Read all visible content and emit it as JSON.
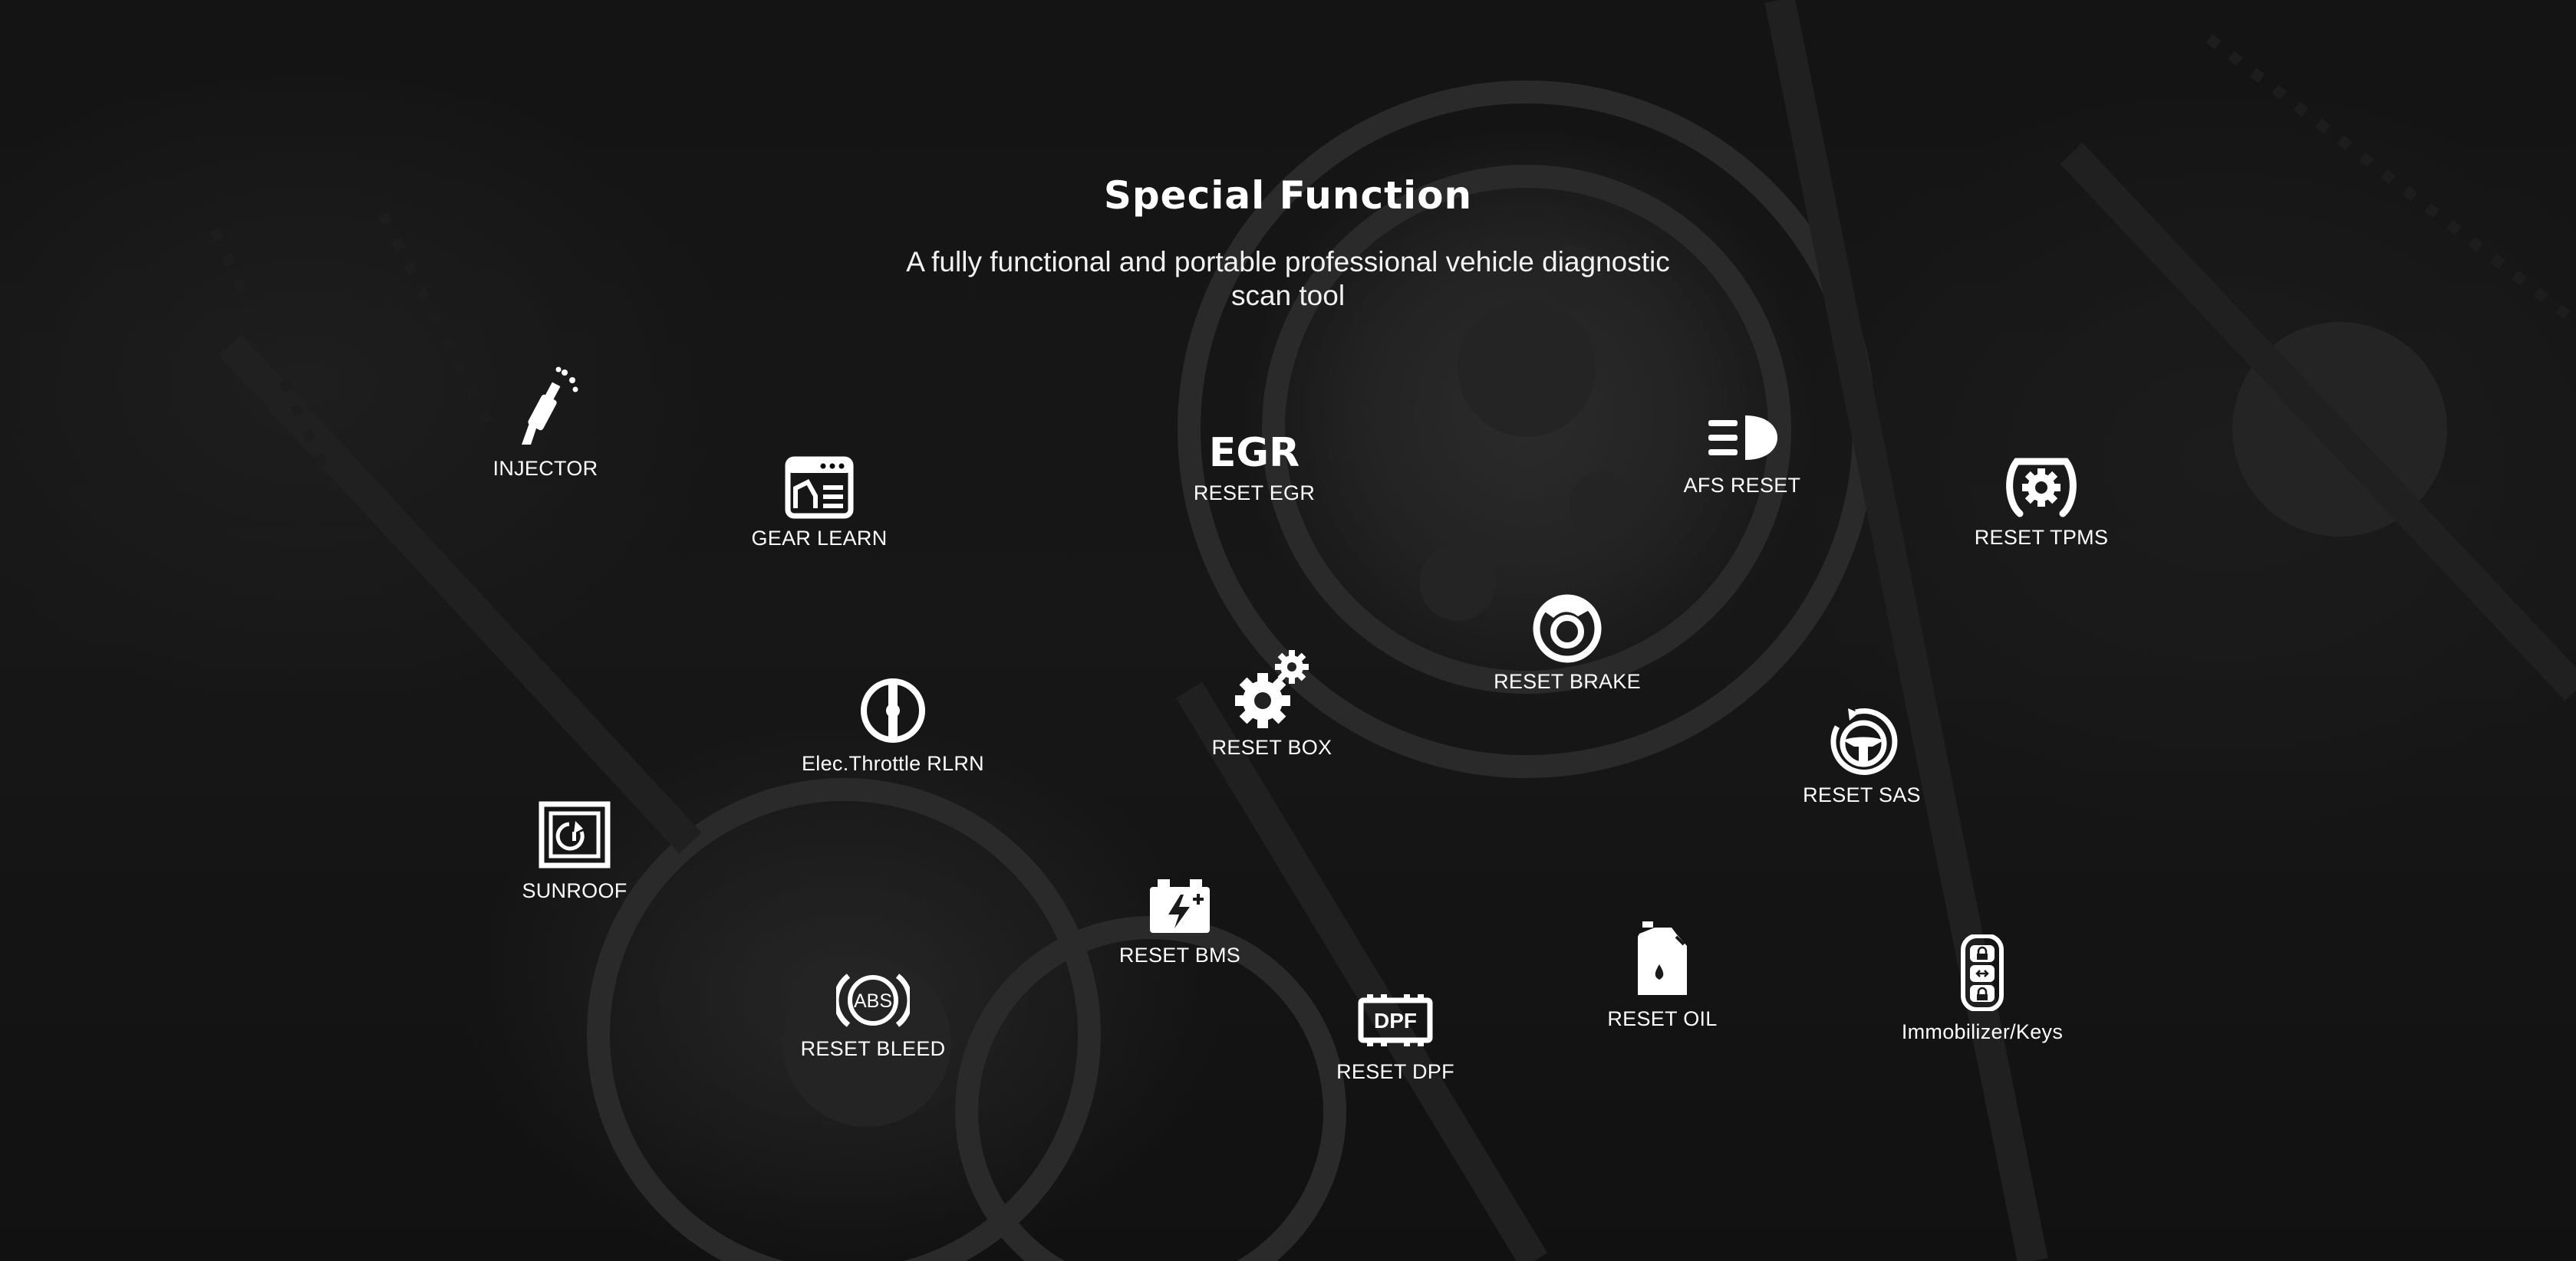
{
  "page": {
    "title": "Special Function",
    "subtitle": "A fully functional and portable professional vehicle diagnostic scan tool"
  },
  "colors": {
    "text": "#ffffff",
    "background": "#161616"
  },
  "features": [
    {
      "id": "injector",
      "label": "INJECTOR",
      "icon": "injector-icon"
    },
    {
      "id": "gear-learn",
      "label": "GEAR LEARN",
      "icon": "gear-learn-icon"
    },
    {
      "id": "reset-egr",
      "label": "RESET EGR",
      "icon": "egr-icon",
      "icon_text": "EGR"
    },
    {
      "id": "afs-reset",
      "label": "AFS RESET",
      "icon": "headlight-icon"
    },
    {
      "id": "reset-tpms",
      "label": "RESET TPMS",
      "icon": "tpms-icon"
    },
    {
      "id": "reset-brake",
      "label": "RESET BRAKE",
      "icon": "brake-icon"
    },
    {
      "id": "elec-throttle",
      "label": "Elec.Throttle RLRN",
      "icon": "throttle-icon"
    },
    {
      "id": "reset-box",
      "label": "RESET BOX",
      "icon": "gears-icon"
    },
    {
      "id": "reset-sas",
      "label": "RESET SAS",
      "icon": "steering-wheel-icon"
    },
    {
      "id": "sunroof",
      "label": "SUNROOF",
      "icon": "sunroof-icon"
    },
    {
      "id": "reset-bms",
      "label": "RESET BMS",
      "icon": "battery-icon"
    },
    {
      "id": "reset-bleed",
      "label": "RESET BLEED",
      "icon": "abs-icon",
      "icon_text": "ABS"
    },
    {
      "id": "reset-dpf",
      "label": "RESET DPF",
      "icon": "dpf-icon",
      "icon_text": "DPF"
    },
    {
      "id": "reset-oil",
      "label": "RESET OIL",
      "icon": "oil-can-icon"
    },
    {
      "id": "immobilizer",
      "label": "Immobilizer/Keys",
      "icon": "key-fob-icon"
    }
  ]
}
